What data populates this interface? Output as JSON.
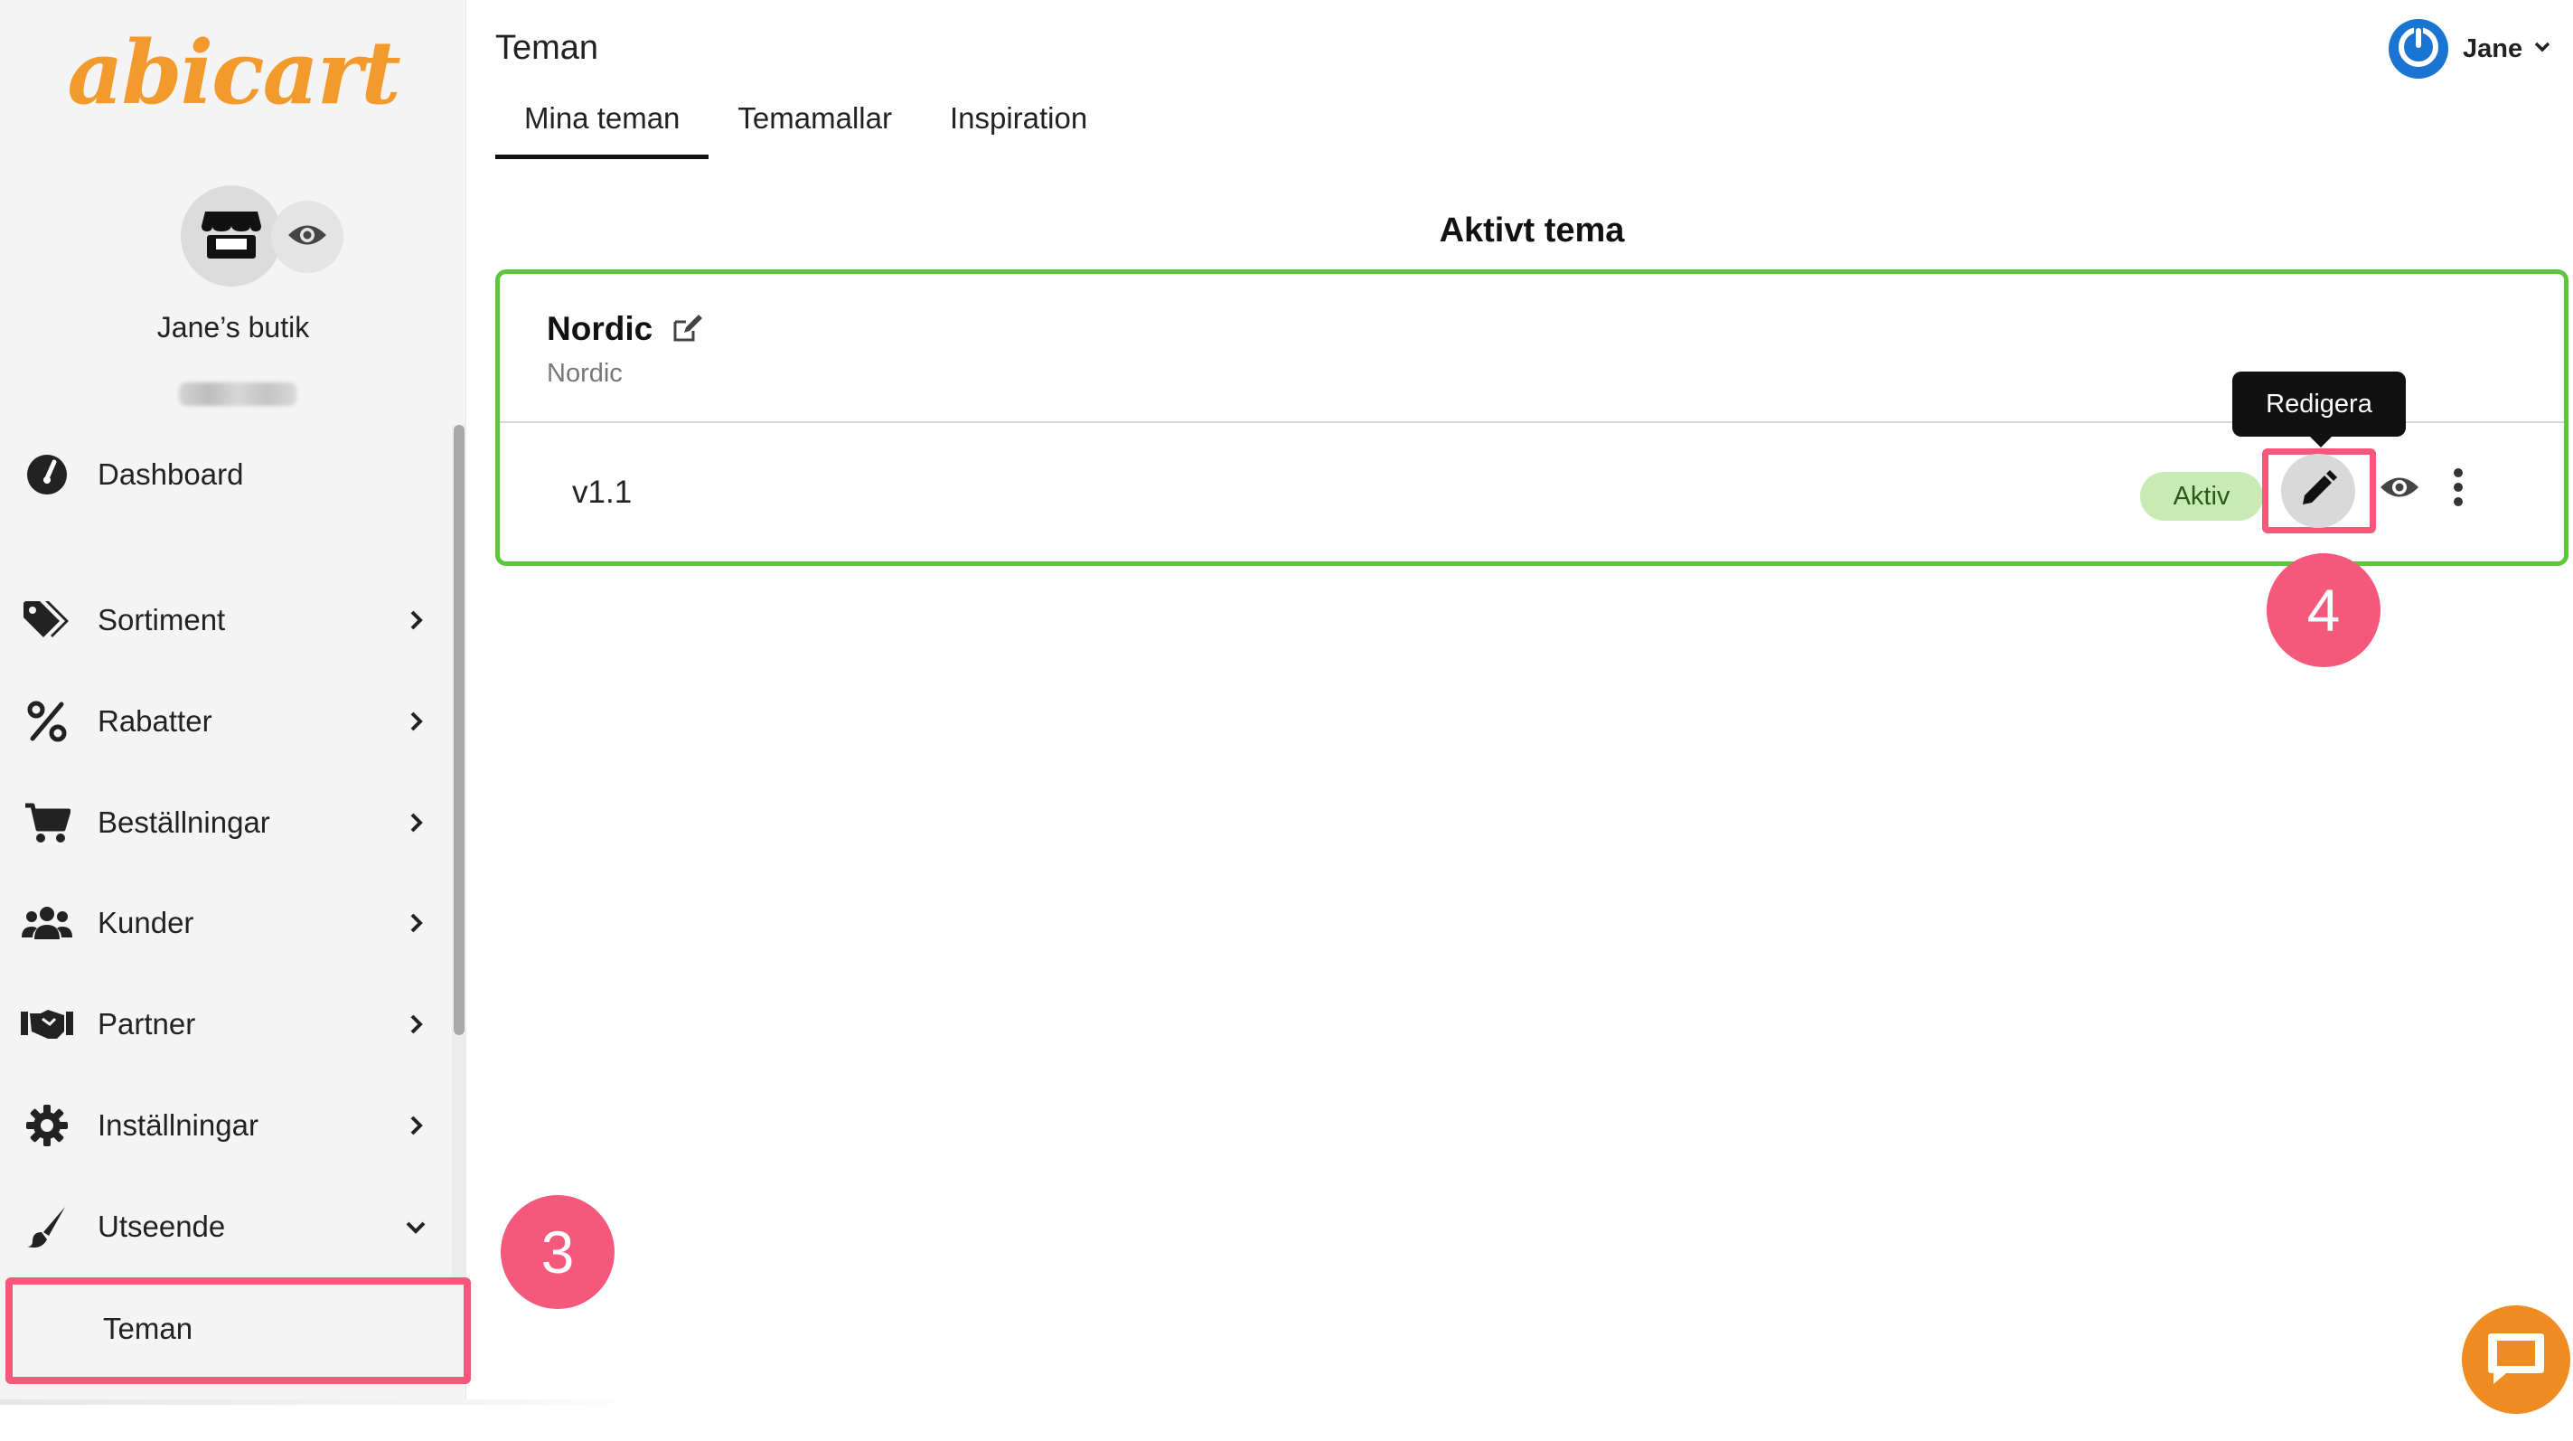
{
  "brand": {
    "logo_text": "abicart",
    "logo_color": "#f39a2c"
  },
  "store": {
    "name": "Jane’s butik"
  },
  "sidebar": {
    "items": [
      {
        "label": "Dashboard",
        "icon": "dashboard-gauge-icon",
        "has_chevron": false
      },
      {
        "label": "Sortiment",
        "icon": "tags-icon",
        "has_chevron": true
      },
      {
        "label": "Rabatter",
        "icon": "percent-icon",
        "has_chevron": true
      },
      {
        "label": "Beställningar",
        "icon": "cart-icon",
        "has_chevron": true
      },
      {
        "label": "Kunder",
        "icon": "users-icon",
        "has_chevron": true
      },
      {
        "label": "Partner",
        "icon": "handshake-icon",
        "has_chevron": true
      },
      {
        "label": "Inställningar",
        "icon": "gear-icon",
        "has_chevron": true
      },
      {
        "label": "Utseende",
        "icon": "paintbrush-icon",
        "has_chevron": true,
        "expanded": true
      }
    ],
    "subitem": {
      "label": "Teman"
    }
  },
  "header": {
    "title": "Teman",
    "tabs": [
      {
        "label": "Mina teman",
        "active": true
      },
      {
        "label": "Temamallar",
        "active": false
      },
      {
        "label": "Inspiration",
        "active": false
      }
    ],
    "user": {
      "name": "Jane",
      "avatar_color": "#1a74d1"
    }
  },
  "main": {
    "section_heading": "Aktivt tema",
    "theme": {
      "name": "Nordic",
      "subtitle": "Nordic",
      "version": "v1.1",
      "status": "Aktiv"
    },
    "tooltip": "Redigera"
  },
  "annotations": {
    "step_3": "3",
    "step_4": "4",
    "highlight_color": "#f4587a"
  },
  "colors": {
    "active_card_border": "#5cc63c",
    "status_badge_bg": "#c8ebb6",
    "chat_button": "#ef8c22"
  }
}
